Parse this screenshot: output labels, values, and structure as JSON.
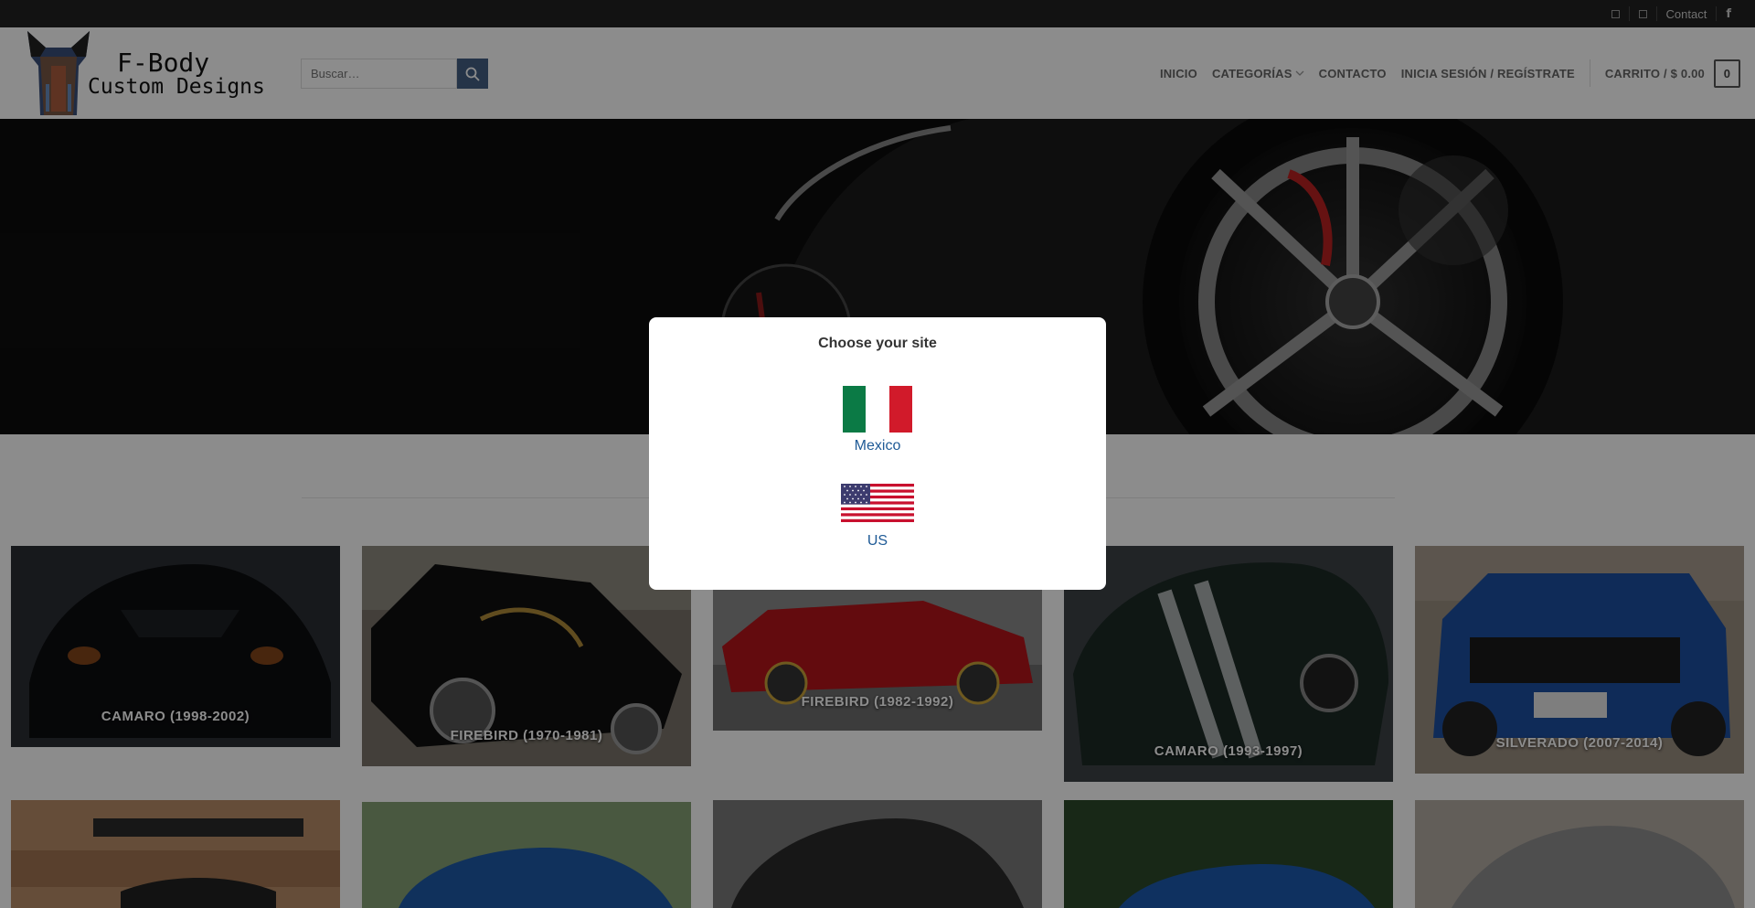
{
  "topbar": {
    "icon1": "square-icon",
    "icon2": "square-icon",
    "contact": "Contact",
    "facebook_glyph": "f"
  },
  "header": {
    "logo_line1": "F-Body",
    "logo_line2": "Custom Designs",
    "search_placeholder": "Buscar…",
    "nav": [
      "INICIO",
      "CATEGORÍAS",
      "CONTACTO",
      "INICIA SESIÓN / REGÍSTRATE"
    ],
    "cart_label": "CARRITO / $ 0.00",
    "cart_count": "0"
  },
  "categories": [
    {
      "label": "CAMARO (1998-2002)"
    },
    {
      "label": "FIREBIRD (1970-1981)"
    },
    {
      "label": "FIREBIRD (1982-1992)"
    },
    {
      "label": "CAMARO (1993-1997)"
    },
    {
      "label": "SILVERADO (2007-2014)"
    }
  ],
  "modal": {
    "title": "Choose your site",
    "options": [
      {
        "label": "Mexico",
        "flag": "mexico-flag"
      },
      {
        "label": "US",
        "flag": "us-flag"
      }
    ]
  },
  "colors": {
    "accent": "#446084",
    "link": "#1e5a96",
    "topbar": "#222222"
  }
}
